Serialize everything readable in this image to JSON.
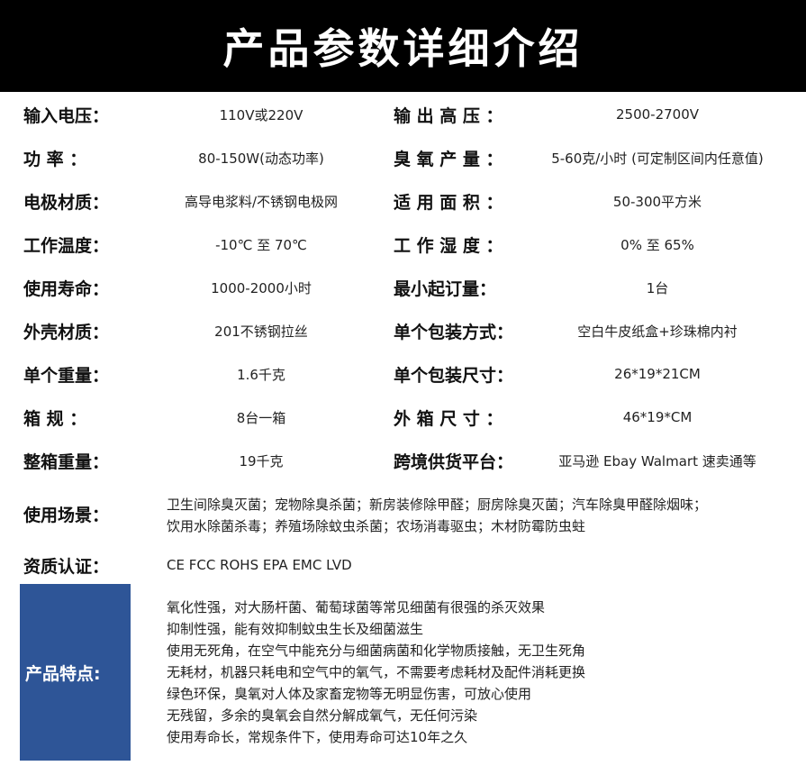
{
  "title": "产品参数详细介绍",
  "rows": [
    {
      "l_label": "输入电压：",
      "l_value": "110V或220V",
      "r_label": "输 出 高 压 ：",
      "r_value": "2500-2700V"
    },
    {
      "l_label": "功 率 ：",
      "l_value": "80-150W(动态功率)",
      "r_label": "臭 氧 产 量 ：",
      "r_value": "5-60克/小时 (可定制区间内任意值)"
    },
    {
      "l_label": "电极材质：",
      "l_value": "高导电浆料/不锈钢电极网",
      "r_label": "适 用 面 积 ：",
      "r_value": "50-300平方米"
    },
    {
      "l_label": "工作温度：",
      "l_value": "-10℃ 至 70℃",
      "r_label": "工 作 湿 度 ：",
      "r_value": "0% 至 65%"
    },
    {
      "l_label": "使用寿命：",
      "l_value": "1000-2000小时",
      "r_label": "最小起订量：",
      "r_value": "1台"
    },
    {
      "l_label": "外壳材质：",
      "l_value": "201不锈钢拉丝",
      "r_label": "单个包装方式：",
      "r_value": "空白牛皮纸盒+珍珠棉内衬"
    },
    {
      "l_label": "单个重量：",
      "l_value": "1.6千克",
      "r_label": "单个包装尺寸：",
      "r_value": "26*19*21CM"
    },
    {
      "l_label": "箱 规 ：",
      "l_value": "8台一箱",
      "r_label": "外 箱 尺 寸 ：",
      "r_value": "46*19*CM"
    },
    {
      "l_label": "整箱重量：",
      "l_value": "19千克",
      "r_label": "跨境供货平台：",
      "r_value": "亚马逊 Ebay Walmart 速卖通等"
    }
  ],
  "scenes": {
    "label": "使用场景：",
    "line1": "卫生间除臭灭菌；宠物除臭杀菌；新房装修除甲醛；厨房除臭灭菌；汽车除臭甲醛除烟味；",
    "line2": "饮用水除菌杀毒；养殖场除蚊虫杀菌；农场消毒驱虫；木材防霉防虫蛀"
  },
  "cert": {
    "label": "资质认证：",
    "value": "CE FCC ROHS EPA EMC LVD"
  },
  "features": {
    "label": "产品特点:",
    "items": [
      "氧化性强，对大肠杆菌、葡萄球菌等常见细菌有很强的杀灭效果",
      "抑制性强，能有效抑制蚊虫生长及细菌滋生",
      "使用无死角，在空气中能充分与细菌病菌和化学物质接触，无卫生死角",
      "无耗材，机器只耗电和空气中的氧气，不需要考虑耗材及配件消耗更换",
      "绿色环保，臭氧对人体及家畜宠物等无明显伤害，可放心使用",
      "无残留，多余的臭氧会自然分解成氧气，无任何污染",
      "使用寿命长，常规条件下，使用寿命可达10年之久"
    ]
  }
}
